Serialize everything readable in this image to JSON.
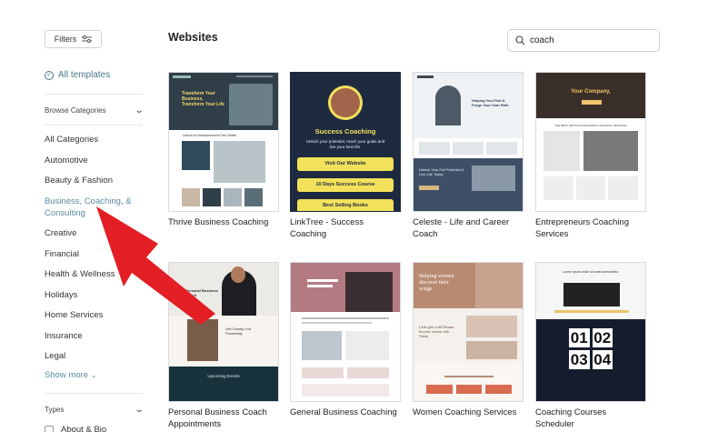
{
  "sidebar": {
    "filters_label": "Filters",
    "all_templates": "All templates",
    "browse_categories": "Browse Categories",
    "categories": [
      "All Categories",
      "Automotive",
      "Beauty & Fashion",
      "Business, Coaching, &\nConsulting",
      "Creative",
      "Financial",
      "Health & Wellness",
      "Holidays",
      "Home Services",
      "Insurance",
      "Legal"
    ],
    "active_category_index": 3,
    "show_more": "Show more",
    "types_label": "Types",
    "types_first_option": "About & Bio"
  },
  "main": {
    "title": "Websites",
    "search_value": "coach"
  },
  "templates": [
    {
      "title": "Thrive Business Coaching"
    },
    {
      "title": "LinkTree - Success Coaching"
    },
    {
      "title": "Celeste - Life and Career Coach"
    },
    {
      "title": "Entrepreneurs Coaching Services"
    },
    {
      "title": "Personal Business Coach Appointments"
    },
    {
      "title": "General Business Coaching"
    },
    {
      "title": "Women Coaching Services"
    },
    {
      "title": "Coaching Courses Scheduler"
    }
  ],
  "thumb_text": {
    "t1_hero": "Transform Your Business, Transform Your Life",
    "t1_sub": "Unlock An Entrepreneurial Your Within",
    "t2_name": "Success Coaching",
    "t2_tagline": "Unlock your potential, reach your goals and live your best life.",
    "t2_btn1": "Visit Our Website",
    "t2_btn2": "10 Days Success Course",
    "t2_btn3": "Best Selling Books",
    "t3_hero": "Helping You Find & Forge Your Own Path",
    "t3_sub": "Unlock Your Full Potential & Live Life Today",
    "t4_hero": "Your Company,",
    "t4_sub": "THE BEST SETTINGS BUSINESS COACHING SERVICES",
    "t5_hero": "Personal Business Coach",
    "t5_mid": "Get Clearly Live Powerfully",
    "t5_events": "Upcoming Events",
    "t7_hero": "Helping women discover their wings.",
    "t7_mid": "Little girls with Dreams become women with Vision",
    "t8_hero": "Lorem ipsum dolor sit amet consectetur",
    "t8_digits": [
      "01",
      "02",
      "03",
      "04"
    ]
  },
  "colors": {
    "accent_link": "#5a8aa0",
    "arrow": "#e31e24",
    "navy": "#1d2a3f",
    "gold": "#f2e15b",
    "rose": "#b98a72"
  }
}
